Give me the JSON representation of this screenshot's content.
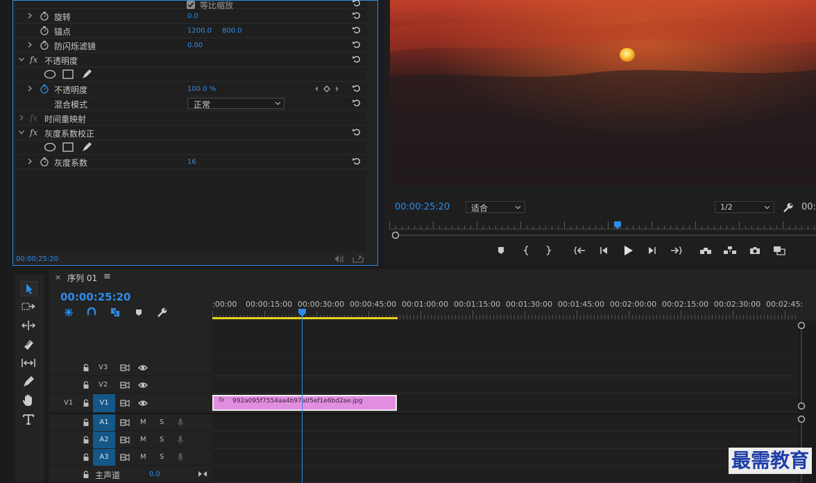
{
  "effects": {
    "uniform_scale_label": "等比缩放",
    "rows": [
      {
        "name": "旋转",
        "value": "0.0"
      },
      {
        "name": "锚点",
        "value": "1200.0",
        "value2": "800.0"
      },
      {
        "name": "防闪烁滤镜",
        "value": "0.00"
      },
      {
        "name": "不透明度"
      },
      {
        "name": "不透明度",
        "value": "100.0 %"
      },
      {
        "name": "混合模式",
        "value": "正常"
      },
      {
        "name": "时间重映射"
      },
      {
        "name": "灰度系数校正"
      },
      {
        "name": "灰度系数",
        "value": "16"
      }
    ],
    "fx_label": "fx",
    "timecode": "00:00:25:20"
  },
  "program": {
    "timecode": "00:00:25:20",
    "fit_select": "适合",
    "resolution_select": "1/2",
    "timecode_right": "00:"
  },
  "timeline": {
    "close": "×",
    "title": "序列 01",
    "menu": "≡",
    "timecode": "00:00:25:20",
    "ruler": [
      ":00:00",
      "00:00:15:00",
      "00:00:30:00",
      "00:00:45:00",
      "00:01:00:00",
      "00:01:15:00",
      "00:01:30:00",
      "00:01:45:00",
      "00:02:00:00",
      "00:02:15:00",
      "00:02:30:00",
      "00:02:45:"
    ],
    "video_tracks": [
      {
        "name": "V3",
        "src": ""
      },
      {
        "name": "V2",
        "src": ""
      },
      {
        "name": "V1",
        "src": "V1"
      }
    ],
    "audio_tracks": [
      {
        "name": "A1",
        "m": "M",
        "s": "S"
      },
      {
        "name": "A2",
        "m": "M",
        "s": "S"
      },
      {
        "name": "A3",
        "m": "M",
        "s": "S"
      }
    ],
    "master": {
      "name": "主声道",
      "value": "0.0"
    },
    "clip": {
      "fx": "fx",
      "name": "992a095f7554aa4b97a05ef1e6bd2ae.jpg"
    }
  },
  "watermark": "最需教育",
  "colors": {
    "accent": "#2d8ceb",
    "clip": "#e28ee0",
    "target": "#155787",
    "work_area": "#e8d41c"
  }
}
